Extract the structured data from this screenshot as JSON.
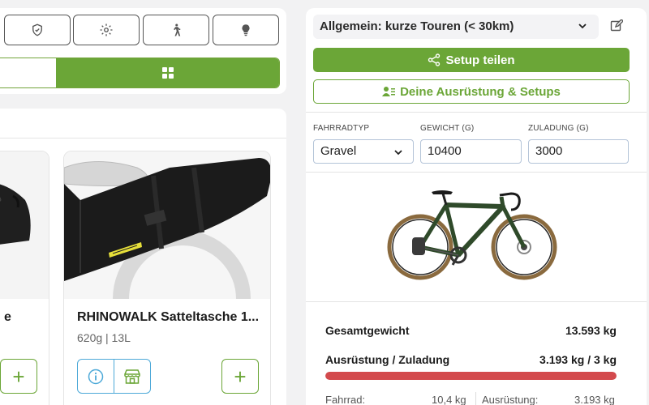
{
  "filters": {
    "icons": [
      "shield-check-icon",
      "gear-icon",
      "hiking-icon",
      "lightbulb-icon"
    ]
  },
  "view_toggle": {
    "active_icon": "grid-icon"
  },
  "products": [
    {
      "title_fragment": "e"
    },
    {
      "title": "RHINOWALK Satteltasche 1...",
      "subtitle": "620g | 13L"
    }
  ],
  "setup": {
    "selected": "Allgemein: kurze Touren (< 30km)",
    "share_label": "Setup teilen",
    "equipment_label": "Deine Ausrüstung & Setups"
  },
  "bike_fields": {
    "type_label": "FAHRRADTYP",
    "type_value": "Gravel",
    "weight_label": "GEWICHT (G)",
    "weight_value": "10400",
    "load_label": "ZULADUNG (G)",
    "load_value": "3000"
  },
  "summary": {
    "total_label": "Gesamtgewicht",
    "total_value": "13.593 kg",
    "load_label": "Ausrüstung / Zuladung",
    "load_value": "3.193 kg / 3 kg",
    "load_fraction": 1.0,
    "bike_label": "Fahrrad:",
    "bike_value": "10,4 kg",
    "equipment_label": "Ausrüstung:",
    "equipment_value": "3.193 kg"
  },
  "colors": {
    "brand_green": "#6ba637",
    "danger_red": "#d34a4d",
    "info_blue": "#4da9d8"
  }
}
